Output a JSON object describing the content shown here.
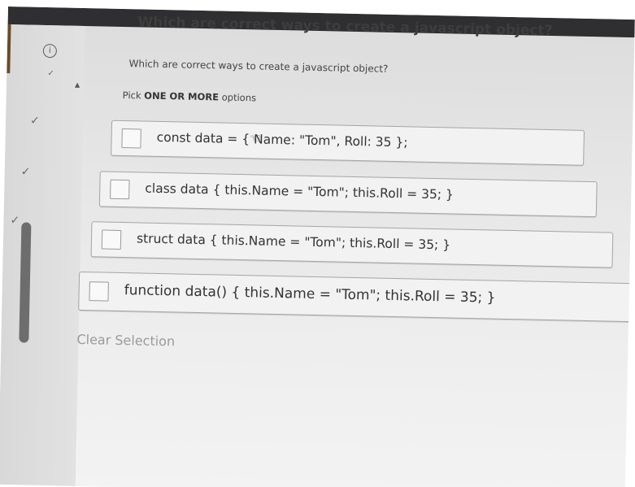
{
  "question": {
    "title": "Which are correct ways to create a javascript object?",
    "subtitle": "Which are correct ways to create a javascript object?",
    "pick_prefix": "Pick ",
    "pick_strong": "ONE OR MORE",
    "pick_suffix": " options"
  },
  "options": [
    {
      "label": "const data = { Name: \"Tom\", Roll: 35 };",
      "checked": false
    },
    {
      "label": "class data { this.Name = \"Tom\"; this.Roll = 35; }",
      "checked": false
    },
    {
      "label": "struct data { this.Name = \"Tom\"; this.Roll = 35; }",
      "checked": false
    },
    {
      "label": "function data() { this.Name = \"Tom\"; this.Roll = 35; }",
      "checked": false
    }
  ],
  "clear_selection_label": "Clear Selection",
  "icons": {
    "info": "info-icon",
    "check": "check-icon",
    "collapse": "chevron-up-icon",
    "cursor": "hand-pointer-icon"
  }
}
